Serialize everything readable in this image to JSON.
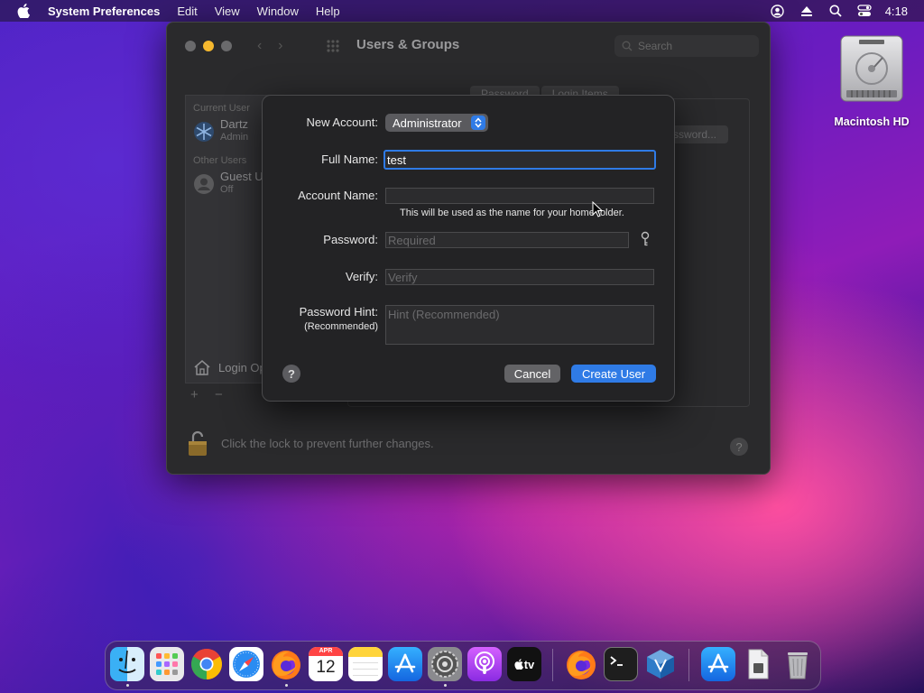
{
  "menubar": {
    "app": "System Preferences",
    "items": [
      "Edit",
      "View",
      "Window",
      "Help"
    ],
    "clock": "4:18"
  },
  "desktop": {
    "hd_label": "Macintosh HD"
  },
  "window": {
    "title": "Users & Groups",
    "search_placeholder": "Search",
    "sidebar": {
      "current_header": "Current User",
      "current_user": {
        "name": "Dartz",
        "role": "Admin"
      },
      "other_header": "Other Users",
      "guest_user": {
        "name": "Guest U",
        "status": "Off"
      },
      "login_options": "Login Op",
      "add": "+",
      "remove": "−"
    },
    "tabs": [
      "Password",
      "Login Items"
    ],
    "change_password": "ssword...",
    "lock_text": "Click the lock to prevent further changes.",
    "help": "?"
  },
  "sheet": {
    "new_account_label": "New Account:",
    "new_account_value": "Administrator",
    "full_name_label": "Full Name:",
    "full_name_value": "test",
    "account_name_label": "Account Name:",
    "account_name_value": "",
    "account_note": "This will be used as the name for your home folder.",
    "password_label": "Password:",
    "password_placeholder": "Required",
    "verify_label": "Verify:",
    "verify_placeholder": "Verify",
    "hint_label": "Password Hint:",
    "hint_sub": "(Recommended)",
    "hint_placeholder": "Hint (Recommended)",
    "help": "?",
    "cancel": "Cancel",
    "create": "Create User"
  },
  "dock": {
    "calendar_month": "APR",
    "calendar_day": "12",
    "tv_label": "tv"
  },
  "colors": {
    "accent": "#2f7be6",
    "sheet_bg": "#232325"
  }
}
